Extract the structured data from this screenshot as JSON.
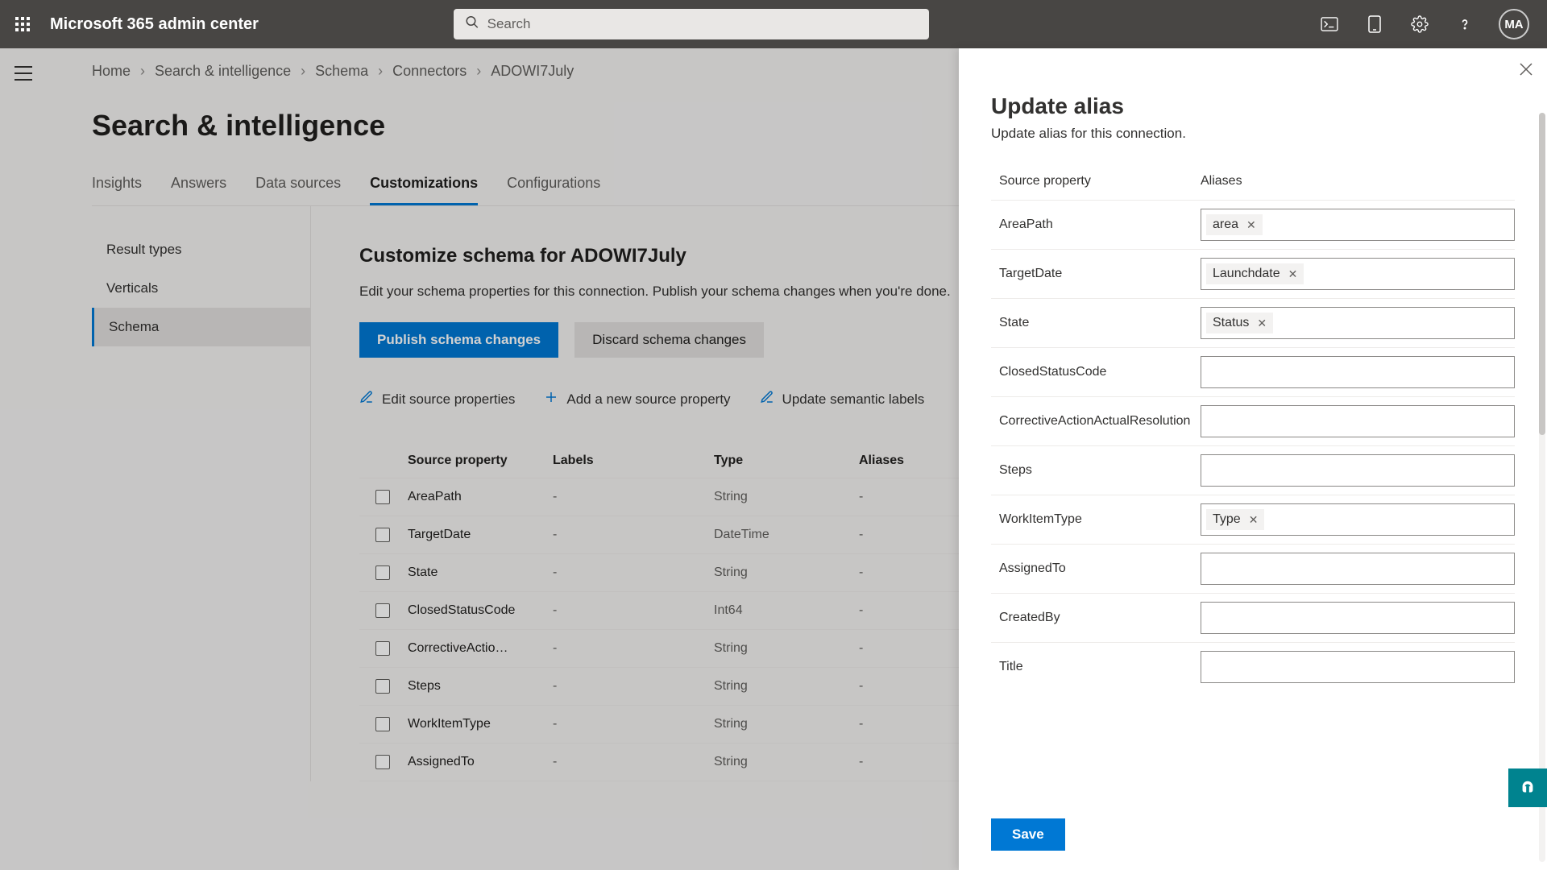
{
  "topbar": {
    "app_title": "Microsoft 365 admin center",
    "search_placeholder": "Search",
    "avatar_initials": "MA"
  },
  "breadcrumb": [
    "Home",
    "Search & intelligence",
    "Schema",
    "Connectors",
    "ADOWI7July"
  ],
  "page_title": "Search & intelligence",
  "tabs": [
    "Insights",
    "Answers",
    "Data sources",
    "Customizations",
    "Configurations"
  ],
  "tabs_active_index": 3,
  "leftnav": [
    "Result types",
    "Verticals",
    "Schema"
  ],
  "leftnav_active_index": 2,
  "schema": {
    "heading": "Customize schema for ADOWI7July",
    "desc": "Edit your schema properties for this connection. Publish your schema changes when you're done.",
    "publish_btn": "Publish schema changes",
    "discard_btn": "Discard schema changes",
    "cmd1": "Edit source properties",
    "cmd2": "Add a new source property",
    "cmd3": "Update semantic labels",
    "columns": [
      "Source property",
      "Labels",
      "Type",
      "Aliases"
    ],
    "rows": [
      {
        "sp": "AreaPath",
        "labels": "-",
        "type": "String",
        "aliases": "-"
      },
      {
        "sp": "TargetDate",
        "labels": "-",
        "type": "DateTime",
        "aliases": "-"
      },
      {
        "sp": "State",
        "labels": "-",
        "type": "String",
        "aliases": "-"
      },
      {
        "sp": "ClosedStatusCode",
        "labels": "-",
        "type": "Int64",
        "aliases": "-"
      },
      {
        "sp": "CorrectiveActio…",
        "labels": "-",
        "type": "String",
        "aliases": "-"
      },
      {
        "sp": "Steps",
        "labels": "-",
        "type": "String",
        "aliases": "-"
      },
      {
        "sp": "WorkItemType",
        "labels": "-",
        "type": "String",
        "aliases": "-"
      },
      {
        "sp": "AssignedTo",
        "labels": "-",
        "type": "String",
        "aliases": "-"
      }
    ]
  },
  "panel": {
    "title": "Update alias",
    "subtitle": "Update alias for this connection.",
    "col1": "Source property",
    "col2": "Aliases",
    "rows": [
      {
        "prop": "AreaPath",
        "tags": [
          "area"
        ]
      },
      {
        "prop": "TargetDate",
        "tags": [
          "Launchdate"
        ]
      },
      {
        "prop": "State",
        "tags": [
          "Status"
        ]
      },
      {
        "prop": "ClosedStatusCode",
        "tags": []
      },
      {
        "prop": "CorrectiveActionActualResolution",
        "tags": []
      },
      {
        "prop": "Steps",
        "tags": []
      },
      {
        "prop": "WorkItemType",
        "tags": [
          "Type"
        ]
      },
      {
        "prop": "AssignedTo",
        "tags": []
      },
      {
        "prop": "CreatedBy",
        "tags": []
      },
      {
        "prop": "Title",
        "tags": []
      }
    ],
    "save": "Save"
  }
}
